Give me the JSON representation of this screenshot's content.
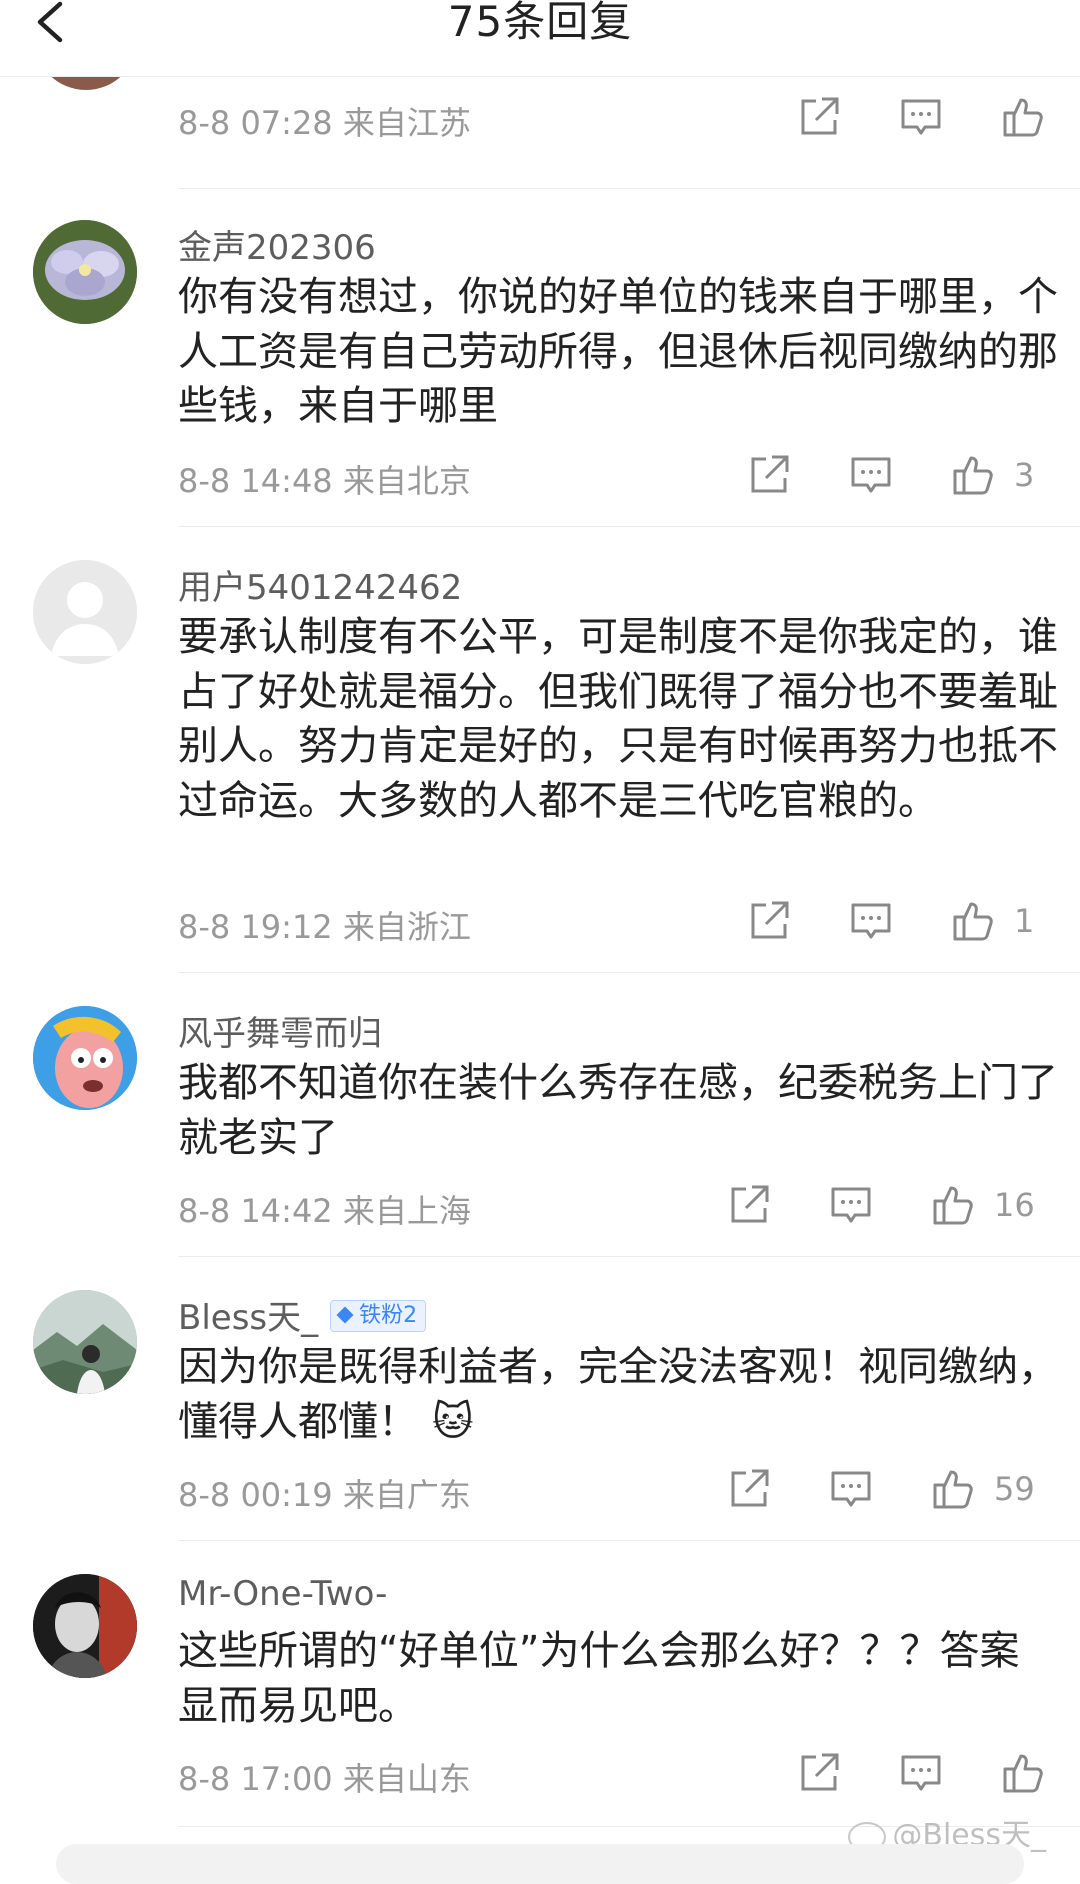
{
  "header": {
    "title": "75条回复"
  },
  "comments": [
    {
      "username": "",
      "text": "",
      "date": "8-8 07:28",
      "location": "来自江苏",
      "likes": ""
    },
    {
      "username": "金声202306",
      "text": "你有没有想过，你说的好单位的钱来自于哪里，个人工资是有自己劳动所得，但退休后视同缴纳的那些钱，来自于哪里",
      "date": "8-8 14:48",
      "location": "来自北京",
      "likes": "3"
    },
    {
      "username": "用户5401242462",
      "text": "要承认制度有不公平，可是制度不是你我定的，谁占了好处就是福分。但我们既得了福分也不要羞耻别人。努力肯定是好的，只是有时候再努力也抵不过命运。大多数的人都不是三代吃官粮的。",
      "date": "8-8 19:12",
      "location": "来自浙江",
      "likes": "1"
    },
    {
      "username": "风乎舞雩而归",
      "text": "我都不知道你在装什么秀存在感，纪委税务上门了就老实了",
      "date": "8-8 14:42",
      "location": "来自上海",
      "likes": "16"
    },
    {
      "username": "Bless天_",
      "badge": "铁粉2",
      "text": "因为你是既得利益者，完全没法客观！视同缴纳，懂得人都懂！",
      "emoji": "🐱",
      "date": "8-8 00:19",
      "location": "来自广东",
      "likes": "59"
    },
    {
      "username": "Mr-One-Two-",
      "text": "这些所谓的“好单位”为什么会那么好？？？答案显而易见吧。",
      "date": "8-8 17:00",
      "location": "来自山东",
      "likes": ""
    }
  ],
  "watermark": "@Bless天_",
  "icons": [
    "back-arrow-icon",
    "share-icon",
    "comment-icon",
    "like-icon",
    "weibo-icon"
  ],
  "colors": {
    "text": "#222222",
    "meta": "#999999",
    "badge": "#3a86f5",
    "divider": "#ececec"
  }
}
